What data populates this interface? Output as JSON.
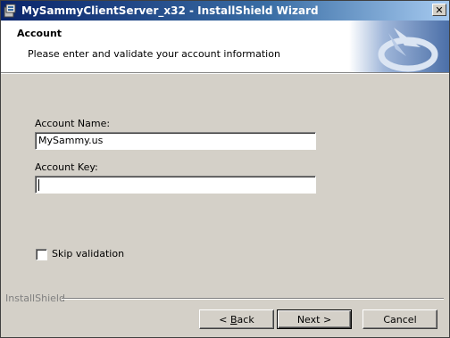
{
  "window": {
    "title": "MySammyClientServer_x32 - InstallShield Wizard",
    "close_glyph": "✕"
  },
  "header": {
    "title": "Account",
    "subtitle": "Please enter and validate your account information"
  },
  "form": {
    "account_name_label": "Account Name:",
    "account_name_value": "MySammy.us",
    "account_key_label": "Account Key:",
    "account_key_value": "",
    "skip_validation_label": "Skip validation",
    "skip_validation_checked": false
  },
  "footer": {
    "brand": "InstallShield",
    "back_prefix": "< ",
    "back_mnemonic": "B",
    "back_rest": "ack",
    "next_label": "Next >",
    "cancel_label": "Cancel"
  },
  "colors": {
    "titlebar_start": "#0a246a",
    "titlebar_end": "#a6caf0",
    "dialog_bg": "#d4d0c8",
    "banner_art": "#5a7fb8"
  },
  "icons": [
    "installer-icon",
    "close-icon",
    "installshield-logo-icon",
    "checkbox-icon"
  ]
}
